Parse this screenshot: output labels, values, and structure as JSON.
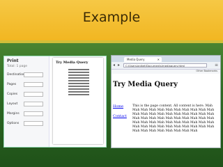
{
  "slide": {
    "title": "Example"
  },
  "print_dialog": {
    "title": "Print",
    "total": "Total: 1 page",
    "rows": [
      "Destination",
      "Pages",
      "Copies",
      "Layout",
      "Margins",
      "Options"
    ],
    "page_heading": "Try Media Query"
  },
  "browser": {
    "tab_label": "Media Query",
    "url": "C:/Users/aniket/Documents/mediaquery.html",
    "bookmarks_label": "Other Bookmarks",
    "page": {
      "heading": "Try Media Query",
      "nav": [
        "Home",
        "Contact"
      ],
      "body": "This is the page content. All content is here. Mah Mah Mah Mah Mah Mah Mah Mah Mah Mah Mah Mah Mah Mah Mah Mah Mah Mah Mah Mah Mah Mah Mah Mah Mah Mah Mah Mah Mah Mah Mah Mah Mah Mah Mah Mah Mah Mah Mah Mah Mah Mah Mah Mah Mah Mah Mah Mah Mah Mah Mah Mah Mah Mah Mah Mah Mah Mah Mah"
    }
  }
}
